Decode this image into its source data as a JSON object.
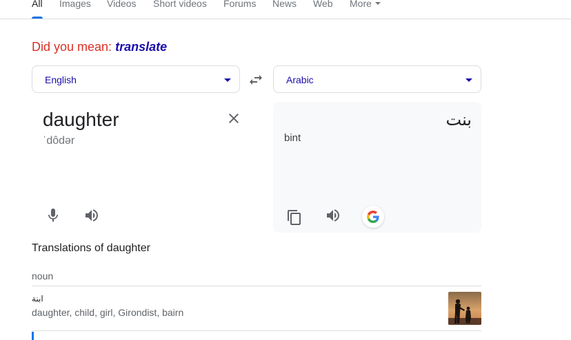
{
  "tabs": [
    {
      "label": "All",
      "active": true
    },
    {
      "label": "Images"
    },
    {
      "label": "Videos"
    },
    {
      "label": "Short videos"
    },
    {
      "label": "Forums"
    },
    {
      "label": "News"
    },
    {
      "label": "Web"
    },
    {
      "label": "More"
    }
  ],
  "did_you_mean": {
    "prefix": "Did you mean:",
    "suggestion": "translate"
  },
  "translator": {
    "source_language": "English",
    "target_language": "Arabic",
    "source_text": "daughter",
    "source_pronunciation": "ˈdôdər",
    "target_text": "بنت",
    "target_transliteration": "bint",
    "icons": {
      "swap": "swap-languages-icon",
      "clear": "close-icon",
      "mic": "microphone-icon",
      "speak": "speaker-icon",
      "copy": "copy-icon",
      "google": "google-logo-icon"
    }
  },
  "translations": {
    "title": "Translations of daughter",
    "part_of_speech": "noun",
    "entries": [
      {
        "word": "ابنة",
        "synonyms": "daughter, child, girl, Girondist, bairn"
      }
    ]
  },
  "colors": {
    "accent_blue": "#1a73e8",
    "link_purple": "#1a0dab",
    "did_you_mean_red": "#d93025"
  }
}
